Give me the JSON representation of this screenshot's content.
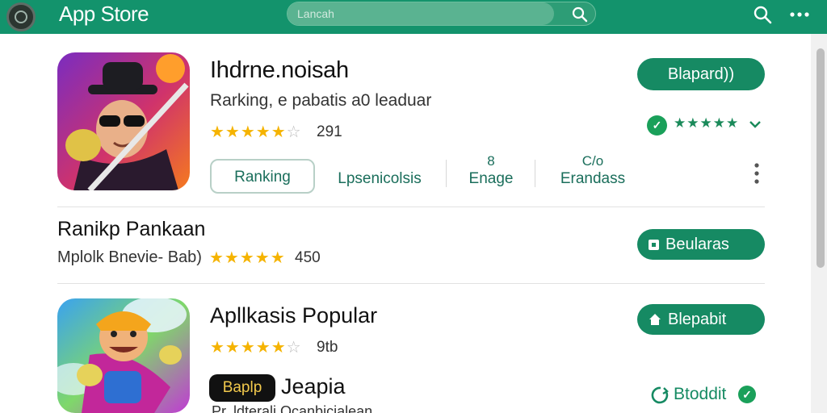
{
  "header": {
    "title": "App Store",
    "search_placeholder": "Lancah"
  },
  "apps": [
    {
      "name": "Ihdrne.noisah",
      "subtitle": "Rarking, e pabatis a0 leaduar",
      "rating_stars": 4.5,
      "rating_count": "291",
      "button_label": "Blapard))",
      "verified_stars": "★★★★★",
      "tabs": [
        {
          "top": "",
          "label": "Ranking"
        },
        {
          "top": "",
          "label": "Lpsenicolsis"
        },
        {
          "top": "8",
          "label": "Enage"
        },
        {
          "top": "C/o",
          "label": "Erandass"
        }
      ]
    },
    {
      "name": "Ranikp Pankaan",
      "subtitle": "Mplolk Bnevie- Bab)",
      "rating_stars": 5,
      "rating_count": "450",
      "button_label": "Beularas"
    },
    {
      "name": "Apllkasis Popular",
      "rating_stars": 4.5,
      "rating_count": "9tb",
      "button_label": "Blepabit",
      "tag_label": "Baplp",
      "tag_name": "Jeapia",
      "status_label": "Btoddit",
      "footer_text": "Pr..ldterali Ocanbicialean"
    }
  ],
  "colors": {
    "header": "#13936c",
    "accent": "#168a63",
    "star": "#f5b300",
    "verified": "#1aa05a"
  }
}
